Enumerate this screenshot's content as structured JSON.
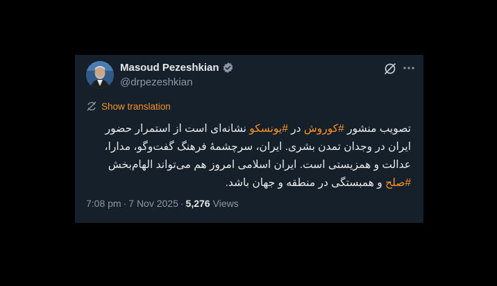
{
  "author": {
    "display_name": "Masoud Pezeshkian",
    "handle": "@drpezeshkian"
  },
  "translate": {
    "label": "Show translation"
  },
  "tweet": {
    "line1": {
      "t1": "تصویب منشور ",
      "h1": "#کوروش",
      "t2": " در ",
      "h2": "#یونسکو",
      "t3": " نشانه‌ای است از استمرار حضور"
    },
    "line2": "ایران در وجدان تمدن بشری. ایران، سرچشمۀ فرهنگ گفت‌وگو، مدارا،",
    "line3": "عدالت و همزیستی است. ایران اسلامی امروز هم می‌تواند الهام‌بخش",
    "line4": {
      "h1": "#صلح",
      "t1": " و همبستگی در منطقه و جهان باشد."
    }
  },
  "meta": {
    "time": "7:08 pm",
    "date": "7 Nov 2025",
    "separator": "·",
    "views_count": "5,276",
    "views_label": "Views"
  },
  "colors": {
    "background": "#15202b",
    "accent": "#f7931e",
    "verified": "#8b98a5"
  },
  "icons": {
    "verified": "verified-badge-icon",
    "grok": "grok-icon",
    "more": "more-icon",
    "translate": "translate-icon"
  }
}
